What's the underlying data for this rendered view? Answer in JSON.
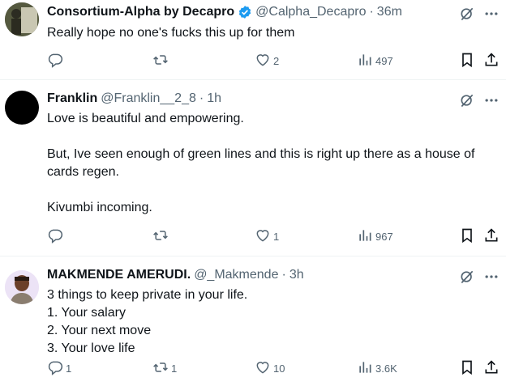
{
  "posts": [
    {
      "name": "Consortium-Alpha by Decapro",
      "verified": true,
      "handle": "@Calpha_Decapro",
      "separator": "·",
      "time": "36m",
      "text_lines": [
        "Really hope no one's fucks this up for them"
      ],
      "replies": "",
      "reposts": "",
      "likes": "2",
      "views": "497"
    },
    {
      "name": "Franklin",
      "verified": false,
      "handle": "@Franklin__2_8",
      "separator": "·",
      "time": "1h",
      "text_lines": [
        "Love is beautiful and empowering.",
        "",
        "But, Ive seen enough of green lines and this is right up there as a house of",
        "cards regen.",
        "",
        "Kivumbi incoming."
      ],
      "replies": "",
      "reposts": "",
      "likes": "1",
      "views": "967"
    },
    {
      "name": "MAKMENDE AMERUDI.",
      "verified": false,
      "handle": "@_Makmende",
      "separator": "·",
      "time": "3h",
      "text_lines": [
        "3 things to keep private in your life.",
        "1. Your salary",
        "2. Your next move",
        "3. Your love life"
      ],
      "replies": "1",
      "reposts": "1",
      "likes": "10",
      "views": "3.6K"
    }
  ],
  "icons": {
    "grok": "grok-icon",
    "more": "more-icon",
    "reply": "reply-icon",
    "repost": "repost-icon",
    "like": "like-icon",
    "views": "views-icon",
    "bookmark": "bookmark-icon",
    "share": "share-icon",
    "verified": "verified-badge-icon"
  },
  "colors": {
    "text": "#0f1419",
    "secondary": "#536471",
    "verified": "#1d9bf0",
    "divider": "#eff3f4"
  }
}
